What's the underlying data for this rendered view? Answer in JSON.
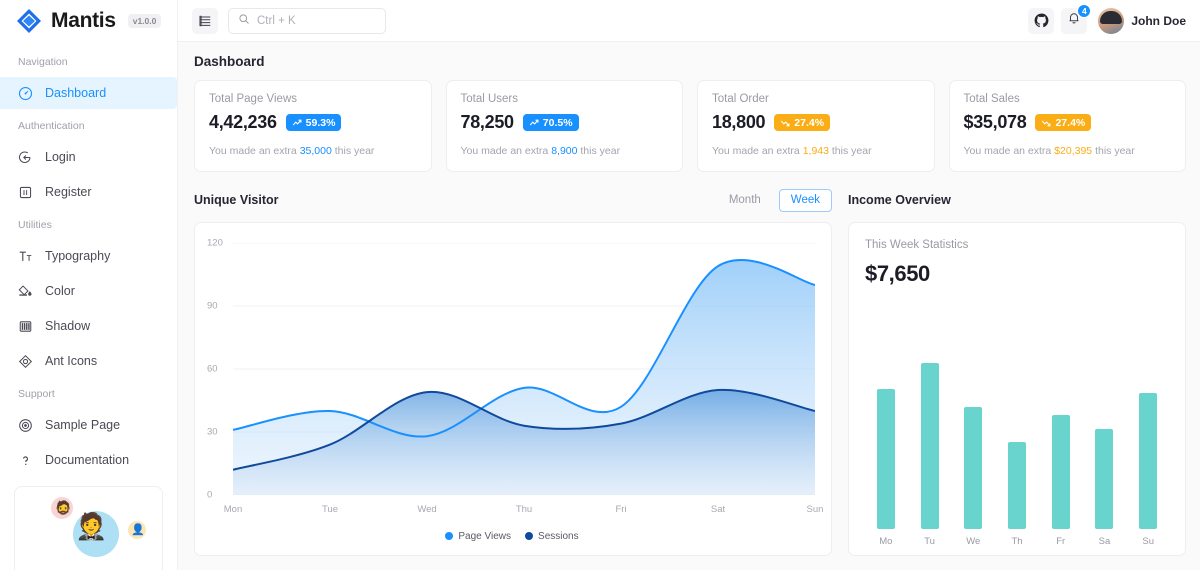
{
  "brand": {
    "name": "Mantis",
    "version": "v1.0.0",
    "logo_icon": "diamond-logo-icon"
  },
  "sidebar": {
    "sections": [
      {
        "caption": "Navigation",
        "items": [
          {
            "label": "Dashboard",
            "icon": "dashboard-icon",
            "active": true
          }
        ]
      },
      {
        "caption": "Authentication",
        "items": [
          {
            "label": "Login",
            "icon": "login-icon",
            "active": false
          },
          {
            "label": "Register",
            "icon": "register-icon",
            "active": false
          }
        ]
      },
      {
        "caption": "Utilities",
        "items": [
          {
            "label": "Typography",
            "icon": "typography-icon",
            "active": false
          },
          {
            "label": "Color",
            "icon": "color-icon",
            "active": false
          },
          {
            "label": "Shadow",
            "icon": "shadow-icon",
            "active": false
          },
          {
            "label": "Ant Icons",
            "icon": "ant-icons-icon",
            "active": false
          }
        ]
      },
      {
        "caption": "Support",
        "items": [
          {
            "label": "Sample Page",
            "icon": "sample-page-icon",
            "active": false
          },
          {
            "label": "Documentation",
            "icon": "question-circle-icon",
            "active": false
          }
        ]
      }
    ]
  },
  "topbar": {
    "menu_icon": "menu-unfold-icon",
    "search": {
      "icon": "search-icon",
      "placeholder": "Ctrl + K",
      "value": ""
    },
    "github_icon": "github-icon",
    "notification": {
      "icon": "bell-icon",
      "count": "4"
    },
    "user": {
      "name": "John Doe",
      "avatar": "user-avatar"
    }
  },
  "page": {
    "title": "Dashboard"
  },
  "stats": [
    {
      "label": "Total Page Views",
      "value": "4,42,236",
      "pct": "59.3%",
      "trend": "up",
      "color": "#1890ff",
      "foot_pre": "You made an extra ",
      "foot_amount": "35,000",
      "foot_post": " this year"
    },
    {
      "label": "Total Users",
      "value": "78,250",
      "pct": "70.5%",
      "trend": "up",
      "color": "#1890ff",
      "foot_pre": "You made an extra ",
      "foot_amount": "8,900",
      "foot_post": " this year"
    },
    {
      "label": "Total Order",
      "value": "18,800",
      "pct": "27.4%",
      "trend": "down",
      "color": "#faad14",
      "foot_pre": "You made an extra ",
      "foot_amount": "1,943",
      "foot_post": " this year"
    },
    {
      "label": "Total Sales",
      "value": "$35,078",
      "pct": "27.4%",
      "trend": "down",
      "color": "#faad14",
      "foot_pre": "You made an extra ",
      "foot_amount": "$20,395",
      "foot_post": " this year"
    }
  ],
  "visitor": {
    "title": "Unique Visitor",
    "toggle": {
      "month": "Month",
      "week": "Week",
      "selected": "Week"
    }
  },
  "income": {
    "title": "Income Overview",
    "stat_label": "This Week Statistics",
    "stat_value": "$7,650"
  },
  "chart_data": [
    {
      "type": "area",
      "title": "Unique Visitor",
      "x": [
        "Mon",
        "Tue",
        "Wed",
        "Thu",
        "Fri",
        "Sat",
        "Sun"
      ],
      "series": [
        {
          "name": "Page Views",
          "values": [
            31,
            40,
            28,
            51,
            42,
            109,
            100
          ],
          "color": "#1890ff"
        },
        {
          "name": "Sessions",
          "values": [
            12,
            24,
            49,
            33,
            34,
            50,
            40
          ],
          "color": "#0f4a9c"
        }
      ],
      "ylim": [
        0,
        120
      ],
      "yticks": [
        0,
        30,
        60,
        90,
        120
      ],
      "xlabel": "",
      "ylabel": "",
      "grid": true,
      "legend_position": "bottom"
    },
    {
      "type": "bar",
      "title": "Income Overview",
      "categories": [
        "Mo",
        "Tu",
        "We",
        "Th",
        "Fr",
        "Sa",
        "Su"
      ],
      "values": [
        80,
        95,
        70,
        50,
        65,
        57,
        78
      ],
      "color": "#69d4cd",
      "ylim": [
        0,
        100
      ],
      "xlabel": "",
      "ylabel": "",
      "grid": false
    }
  ]
}
